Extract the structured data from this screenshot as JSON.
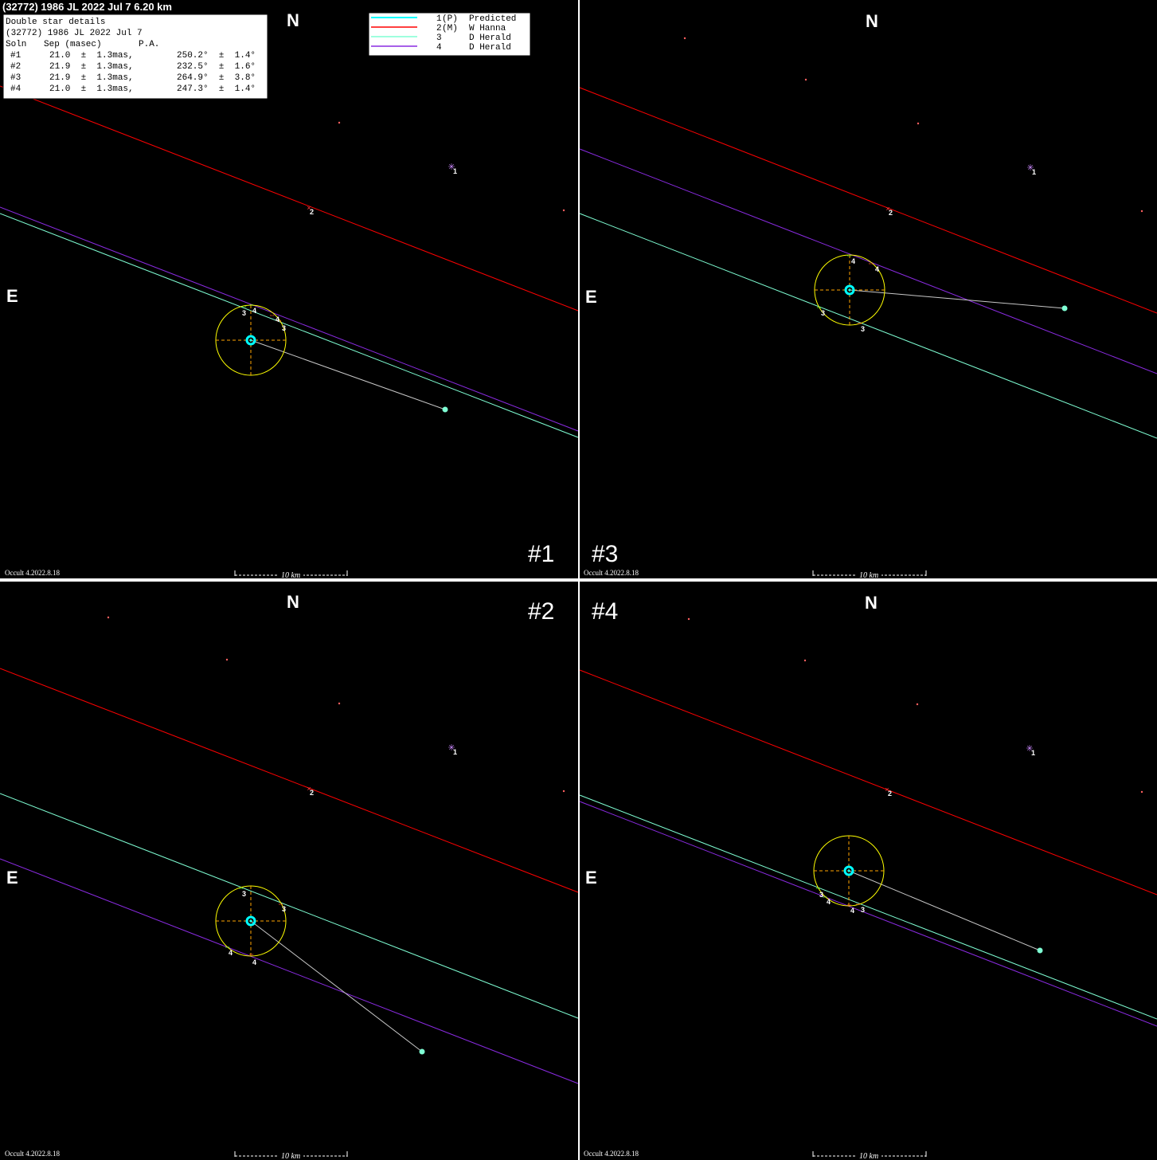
{
  "title": "(32772) 1986 JL  2022 Jul 7   6.20 km",
  "compass": {
    "north": "N",
    "east": "E"
  },
  "footer": "Occult 4.2022.8.18",
  "scale_label": "10 km",
  "panels": [
    {
      "label": "#1",
      "chords": [
        {
          "color": "#ff0000"
        },
        {
          "color": "#7fffd4"
        },
        {
          "color": "#8a2be2"
        }
      ]
    },
    {
      "label": "#3"
    },
    {
      "label": "#2"
    },
    {
      "label": "#4"
    }
  ],
  "double_star_box": {
    "heading": "Double star details",
    "object": "(32772) 1986 JL 2022 Jul 7",
    "columns": [
      "Soln",
      "Sep (masec)",
      "P.A."
    ],
    "rows": [
      {
        "soln": "#1",
        "sep": "21.0  ±  1.3mas,",
        "pa": "250.2°  ±  1.4°"
      },
      {
        "soln": "#2",
        "sep": "21.9  ±  1.3mas,",
        "pa": "232.5°  ±  1.6°"
      },
      {
        "soln": "#3",
        "sep": "21.9  ±  1.3mas,",
        "pa": "264.9°  ±  3.8°"
      },
      {
        "soln": "#4",
        "sep": "21.0  ±  1.3mas,",
        "pa": "247.3°  ±  1.4°"
      }
    ]
  },
  "legend": [
    {
      "num": "1",
      "code": "(P)",
      "observer": "Predicted",
      "color": "#00ffff"
    },
    {
      "num": "2",
      "code": "(M)",
      "observer": "W Hanna",
      "color": "#ff0000"
    },
    {
      "num": "3",
      "code": "",
      "observer": "D Herald",
      "color": "#7fffd4"
    },
    {
      "num": "4",
      "code": "",
      "observer": "D Herald",
      "color": "#8a2be2"
    }
  ],
  "chord_labels": {
    "c1": "1",
    "c2": "2",
    "c3": "3",
    "c4": "4"
  },
  "colors": {
    "background": "#000000",
    "ellipse": "#ffff00",
    "axes": "#ffa500",
    "predicted": "#00ffff",
    "secondary": "#7fffd4",
    "connector": "#c8c8c8",
    "star": "#ff6060"
  }
}
